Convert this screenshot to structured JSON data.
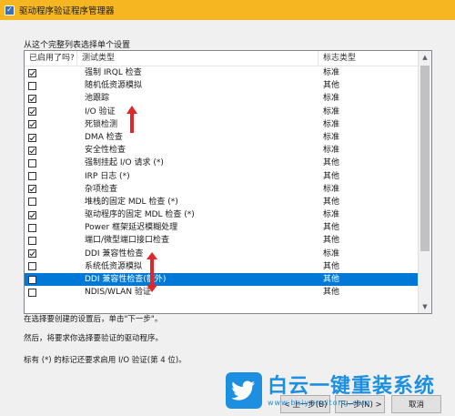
{
  "window": {
    "title": "驱动程序验证程序管理器"
  },
  "list": {
    "section_label": "从这个完整列表选择单个设置",
    "columns": [
      "已启用了吗?",
      "测试类型",
      "标志类型"
    ],
    "rows": [
      {
        "checked": true,
        "name": "强制 IRQL 检查",
        "type": "标准"
      },
      {
        "checked": false,
        "name": "随机低资源模拟",
        "type": "其他"
      },
      {
        "checked": true,
        "name": "池跟踪",
        "type": "标准"
      },
      {
        "checked": true,
        "name": "I/O 验证",
        "type": "标准"
      },
      {
        "checked": true,
        "name": "死锁检测",
        "type": "标准"
      },
      {
        "checked": true,
        "name": "DMA 检查",
        "type": "标准"
      },
      {
        "checked": true,
        "name": "安全性检查",
        "type": "标准"
      },
      {
        "checked": false,
        "name": "强制挂起 I/O 请求 (*)",
        "type": "其他"
      },
      {
        "checked": false,
        "name": "IRP 日志 (*)",
        "type": "其他"
      },
      {
        "checked": true,
        "name": "杂项检查",
        "type": "标准"
      },
      {
        "checked": false,
        "name": "堆栈的固定 MDL 检查 (*)",
        "type": "其他"
      },
      {
        "checked": true,
        "name": "驱动程序的固定 MDL 检查 (*)",
        "type": "标准"
      },
      {
        "checked": false,
        "name": "Power 框架延迟模糊处理",
        "type": "其他"
      },
      {
        "checked": false,
        "name": "端口/微型端口接口检查",
        "type": "其他"
      },
      {
        "checked": true,
        "name": "DDI 兼容性检查",
        "type": "标准"
      },
      {
        "checked": false,
        "name": "系统低资源模拟",
        "type": "其他"
      },
      {
        "checked": false,
        "name": "DDI 兼容性检查(额外)",
        "type": "其他",
        "selected": true
      },
      {
        "checked": false,
        "name": "NDIS/WLAN 验证",
        "type": "其他"
      }
    ]
  },
  "info": {
    "line1": "在选择要创建的设置后，单击\"下一步\"。",
    "line2": "然后，将要求你选择要验证的驱动程序。",
    "line3": "标有 (*) 的标记还要求启用 I/O 验证(第 4 位)。"
  },
  "buttons": {
    "prev": "< 上一步(B)",
    "next": "下一步(N) >",
    "cancel": "取消"
  },
  "watermark": {
    "name": "白云一键重装系统",
    "url": "www.baiyunxitong.com"
  },
  "colors": {
    "titlebar": "#f5b622",
    "selection": "#0078d7",
    "arrow": "#e0262a",
    "watermark": "#1d8fe1"
  },
  "icons": [
    "app-check-icon",
    "scroll-up-icon",
    "scroll-down-icon",
    "twitter-bird-icon"
  ]
}
